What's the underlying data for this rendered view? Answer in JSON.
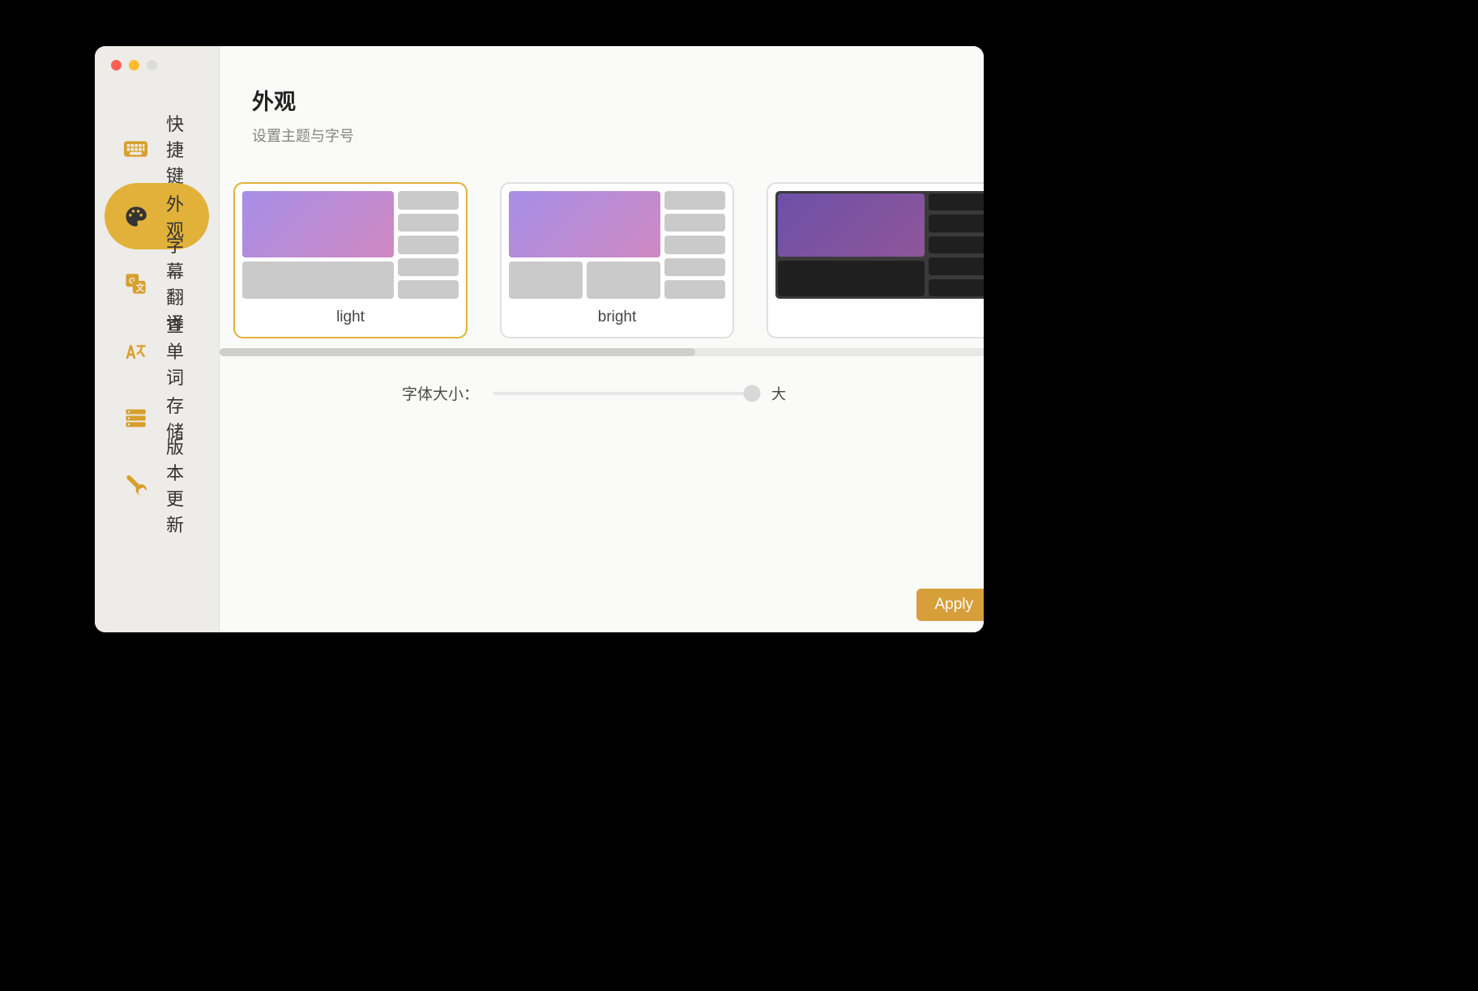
{
  "colors": {
    "accent": "#e1b13a",
    "apply": "#d79f3a"
  },
  "sidebar": {
    "items": [
      {
        "id": "shortcuts",
        "icon": "keyboard-icon",
        "label": "快捷键"
      },
      {
        "id": "appearance",
        "icon": "palette-icon",
        "label": "外观",
        "active": true
      },
      {
        "id": "translate",
        "icon": "translate-icon",
        "label": "字幕翻译"
      },
      {
        "id": "lookup",
        "icon": "dictionary-icon",
        "label": "查单词"
      },
      {
        "id": "storage",
        "icon": "storage-icon",
        "label": "存储"
      },
      {
        "id": "update",
        "icon": "wrench-icon",
        "label": "版本更新"
      }
    ]
  },
  "header": {
    "title": "外观",
    "subtitle": "设置主题与字号"
  },
  "themes": [
    {
      "id": "light",
      "label": "light",
      "selected": true,
      "dark": false
    },
    {
      "id": "bright",
      "label": "bright",
      "selected": false,
      "dark": false
    },
    {
      "id": "dark",
      "label": "",
      "selected": false,
      "dark": true
    }
  ],
  "font": {
    "label": "字体大小：",
    "max_label": "大",
    "value": 98
  },
  "buttons": {
    "apply": "Apply"
  }
}
